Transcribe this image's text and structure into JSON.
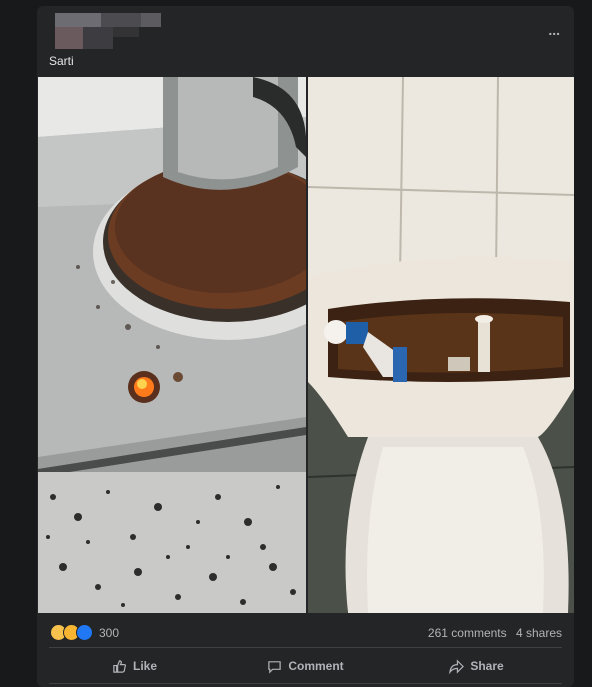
{
  "post": {
    "author": "Sarti",
    "more_icon": "ellipsis-icon",
    "more_label": "..."
  },
  "photos": [
    {
      "name": "stove-photo",
      "description": "rusty electric stove burner with pot and lit indicator"
    },
    {
      "name": "toilet-photo",
      "description": "toilet cistern open with brown stained water"
    }
  ],
  "stats": {
    "reaction_count": "300",
    "reactions": [
      "haha",
      "sad",
      "like"
    ],
    "comments": "261 comments",
    "shares": "4 shares"
  },
  "actions": {
    "like": "Like",
    "comment": "Comment",
    "share": "Share"
  },
  "colors": {
    "background": "#18191a",
    "card": "#242526",
    "text_secondary": "#b0b3b8",
    "like_blue": "#2078f4",
    "reaction_yellow": "#f7c14d"
  }
}
